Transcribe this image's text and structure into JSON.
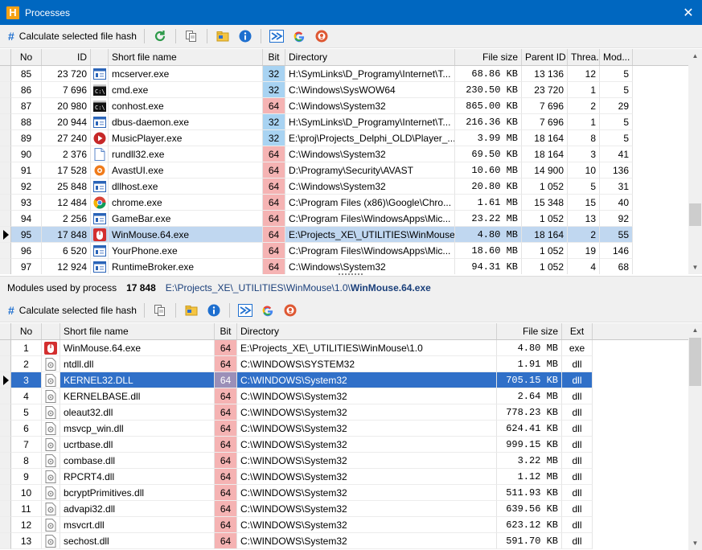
{
  "window": {
    "title": "Processes",
    "close": "✕",
    "app_icon_letter": "H"
  },
  "process_toolbar": {
    "hash_label": "Calculate selected file hash",
    "buttons": [
      "refresh-icon",
      "copy-icon",
      "open-folder-icon",
      "info-icon",
      "visual-studio-icon",
      "google-icon",
      "duckduckgo-icon"
    ]
  },
  "process_table": {
    "columns": {
      "no": "No",
      "id": "ID",
      "name": "Short file name",
      "bit": "Bit",
      "dir": "Directory",
      "size": "File size",
      "parent": "Parent ID",
      "threads": "Threa...",
      "modules": "Mod..."
    },
    "selected_row": 10,
    "rows": [
      {
        "no": "85",
        "id": "23 720",
        "icon": "app-window-icon",
        "name": "mcserver.exe",
        "bit": "32",
        "dir": "H:\\SymLinks\\D_Programy\\Internet\\T...",
        "size": "68.86 KB",
        "parent": "13 136",
        "threads": "12",
        "modules": "5"
      },
      {
        "no": "86",
        "id": "7 696",
        "icon": "console-icon",
        "name": "cmd.exe",
        "bit": "32",
        "dir": "C:\\Windows\\SysWOW64",
        "size": "230.50 KB",
        "parent": "23 720",
        "threads": "1",
        "modules": "5"
      },
      {
        "no": "87",
        "id": "20 980",
        "icon": "console-icon",
        "name": "conhost.exe",
        "bit": "64",
        "dir": "C:\\Windows\\System32",
        "size": "865.00 KB",
        "parent": "7 696",
        "threads": "2",
        "modules": "29"
      },
      {
        "no": "88",
        "id": "20 944",
        "icon": "app-window-icon",
        "name": "dbus-daemon.exe",
        "bit": "32",
        "dir": "H:\\SymLinks\\D_Programy\\Internet\\T...",
        "size": "216.36 KB",
        "parent": "7 696",
        "threads": "1",
        "modules": "5"
      },
      {
        "no": "89",
        "id": "27 240",
        "icon": "music-player-icon",
        "name": "MusicPlayer.exe",
        "bit": "32",
        "dir": "E:\\proj\\Projects_Delphi_OLD\\Player_...",
        "size": "3.99 MB",
        "parent": "18 164",
        "threads": "8",
        "modules": "5"
      },
      {
        "no": "90",
        "id": "2 376",
        "icon": "document-icon",
        "name": "rundll32.exe",
        "bit": "64",
        "dir": "C:\\Windows\\System32",
        "size": "69.50 KB",
        "parent": "18 164",
        "threads": "3",
        "modules": "41"
      },
      {
        "no": "91",
        "id": "17 528",
        "icon": "avast-icon",
        "name": "AvastUI.exe",
        "bit": "64",
        "dir": "D:\\Programy\\Security\\AVAST",
        "size": "10.60 MB",
        "parent": "14 900",
        "threads": "10",
        "modules": "136"
      },
      {
        "no": "92",
        "id": "25 848",
        "icon": "app-window-icon",
        "name": "dllhost.exe",
        "bit": "64",
        "dir": "C:\\Windows\\System32",
        "size": "20.80 KB",
        "parent": "1 052",
        "threads": "5",
        "modules": "31"
      },
      {
        "no": "93",
        "id": "12 484",
        "icon": "chrome-icon",
        "name": "chrome.exe",
        "bit": "64",
        "dir": "C:\\Program Files (x86)\\Google\\Chro...",
        "size": "1.61 MB",
        "parent": "15 348",
        "threads": "15",
        "modules": "40"
      },
      {
        "no": "94",
        "id": "2 256",
        "icon": "app-window-icon",
        "name": "GameBar.exe",
        "bit": "64",
        "dir": "C:\\Program Files\\WindowsApps\\Mic...",
        "size": "23.22 MB",
        "parent": "1 052",
        "threads": "13",
        "modules": "92"
      },
      {
        "no": "95",
        "id": "17 848",
        "icon": "mouse-app-icon",
        "name": "WinMouse.64.exe",
        "bit": "64",
        "dir": "E:\\Projects_XE\\_UTILITIES\\WinMouse...",
        "size": "4.80 MB",
        "parent": "18 164",
        "threads": "2",
        "modules": "55"
      },
      {
        "no": "96",
        "id": "6 520",
        "icon": "app-window-icon",
        "name": "YourPhone.exe",
        "bit": "64",
        "dir": "C:\\Program Files\\WindowsApps\\Mic...",
        "size": "18.60 MB",
        "parent": "1 052",
        "threads": "19",
        "modules": "146"
      },
      {
        "no": "97",
        "id": "12 924",
        "icon": "app-window-icon",
        "name": "RuntimeBroker.exe",
        "bit": "64",
        "dir": "C:\\Windows\\System32",
        "size": "94.31 KB",
        "parent": "1 052",
        "threads": "4",
        "modules": "68"
      }
    ]
  },
  "modules_info": {
    "label": "Modules used by process",
    "pid": "17 848",
    "path": "E:\\Projects_XE\\_UTILITIES\\WinMouse\\1.0\\",
    "file": "WinMouse.64.exe"
  },
  "module_toolbar": {
    "hash_label": "Calculate selected file hash",
    "buttons": [
      "copy-icon",
      "open-folder-icon",
      "info-icon",
      "visual-studio-icon",
      "google-icon",
      "duckduckgo-icon"
    ]
  },
  "module_table": {
    "columns": {
      "no": "No",
      "name": "Short file name",
      "bit": "Bit",
      "dir": "Directory",
      "size": "File size",
      "ext": "Ext"
    },
    "selected_row": 2,
    "rows": [
      {
        "no": "1",
        "icon": "mouse-app-icon",
        "name": "WinMouse.64.exe",
        "bit": "64",
        "dir": "E:\\Projects_XE\\_UTILITIES\\WinMouse\\1.0",
        "size": "4.80 MB",
        "ext": "exe"
      },
      {
        "no": "2",
        "icon": "dll-icon",
        "name": "ntdll.dll",
        "bit": "64",
        "dir": "C:\\WINDOWS\\SYSTEM32",
        "size": "1.91 MB",
        "ext": "dll"
      },
      {
        "no": "3",
        "icon": "dll-icon",
        "name": "KERNEL32.DLL",
        "bit": "64",
        "dir": "C:\\WINDOWS\\System32",
        "size": "705.15 KB",
        "ext": "dll"
      },
      {
        "no": "4",
        "icon": "dll-icon",
        "name": "KERNELBASE.dll",
        "bit": "64",
        "dir": "C:\\WINDOWS\\System32",
        "size": "2.64 MB",
        "ext": "dll"
      },
      {
        "no": "5",
        "icon": "dll-icon",
        "name": "oleaut32.dll",
        "bit": "64",
        "dir": "C:\\WINDOWS\\System32",
        "size": "778.23 KB",
        "ext": "dll"
      },
      {
        "no": "6",
        "icon": "dll-icon",
        "name": "msvcp_win.dll",
        "bit": "64",
        "dir": "C:\\WINDOWS\\System32",
        "size": "624.41 KB",
        "ext": "dll"
      },
      {
        "no": "7",
        "icon": "dll-icon",
        "name": "ucrtbase.dll",
        "bit": "64",
        "dir": "C:\\WINDOWS\\System32",
        "size": "999.15 KB",
        "ext": "dll"
      },
      {
        "no": "8",
        "icon": "dll-icon",
        "name": "combase.dll",
        "bit": "64",
        "dir": "C:\\WINDOWS\\System32",
        "size": "3.22 MB",
        "ext": "dll"
      },
      {
        "no": "9",
        "icon": "dll-icon",
        "name": "RPCRT4.dll",
        "bit": "64",
        "dir": "C:\\WINDOWS\\System32",
        "size": "1.12 MB",
        "ext": "dll"
      },
      {
        "no": "10",
        "icon": "dll-icon",
        "name": "bcryptPrimitives.dll",
        "bit": "64",
        "dir": "C:\\WINDOWS\\System32",
        "size": "511.93 KB",
        "ext": "dll"
      },
      {
        "no": "11",
        "icon": "dll-icon",
        "name": "advapi32.dll",
        "bit": "64",
        "dir": "C:\\WINDOWS\\System32",
        "size": "639.56 KB",
        "ext": "dll"
      },
      {
        "no": "12",
        "icon": "dll-icon",
        "name": "msvcrt.dll",
        "bit": "64",
        "dir": "C:\\WINDOWS\\System32",
        "size": "623.12 KB",
        "ext": "dll"
      },
      {
        "no": "13",
        "icon": "dll-icon",
        "name": "sechost.dll",
        "bit": "64",
        "dir": "C:\\WINDOWS\\System32",
        "size": "591.70 KB",
        "ext": "dll"
      }
    ]
  },
  "colors": {
    "titlebar": "#0067c0",
    "bit64": "#f5b3b3",
    "bit32": "#a8d3f2",
    "selection": "#3070c8",
    "selection_light": "#c0d7f0"
  }
}
